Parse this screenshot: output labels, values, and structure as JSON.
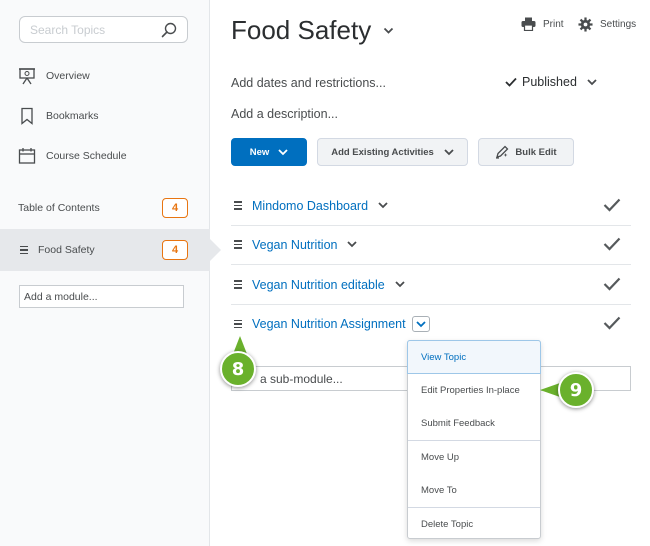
{
  "sidebar": {
    "search_placeholder": "Search Topics",
    "nav": [
      {
        "label": "Overview",
        "icon": "presentation-icon"
      },
      {
        "label": "Bookmarks",
        "icon": "bookmark-icon"
      },
      {
        "label": "Course Schedule",
        "icon": "calendar-icon"
      }
    ],
    "toc_label": "Table of Contents",
    "toc_count": "4",
    "active_module": {
      "label": "Food Safety",
      "count": "4"
    },
    "add_module_label": "Add a module..."
  },
  "header": {
    "title": "Food Safety",
    "print_label": "Print",
    "settings_label": "Settings",
    "dates_label": "Add dates and restrictions...",
    "published_label": "Published",
    "description_label": "Add a description..."
  },
  "toolbar": {
    "new_label": "New",
    "add_existing_label": "Add Existing Activities",
    "bulk_edit_label": "Bulk Edit"
  },
  "topics": [
    {
      "name": "Mindomo Dashboard"
    },
    {
      "name": "Vegan Nutrition"
    },
    {
      "name": "Vegan Nutrition editable"
    },
    {
      "name": "Vegan Nutrition Assignment"
    }
  ],
  "submodule_label": "a sub-module...",
  "context_menu": [
    "View Topic",
    "Edit Properties In-place",
    "Submit Feedback",
    "Move Up",
    "Move To",
    "Delete Topic"
  ],
  "callouts": {
    "first": "8",
    "second": "9"
  },
  "colors": {
    "accent": "#006fbf",
    "badge": "#e87511",
    "callout": "#6ab12c"
  }
}
